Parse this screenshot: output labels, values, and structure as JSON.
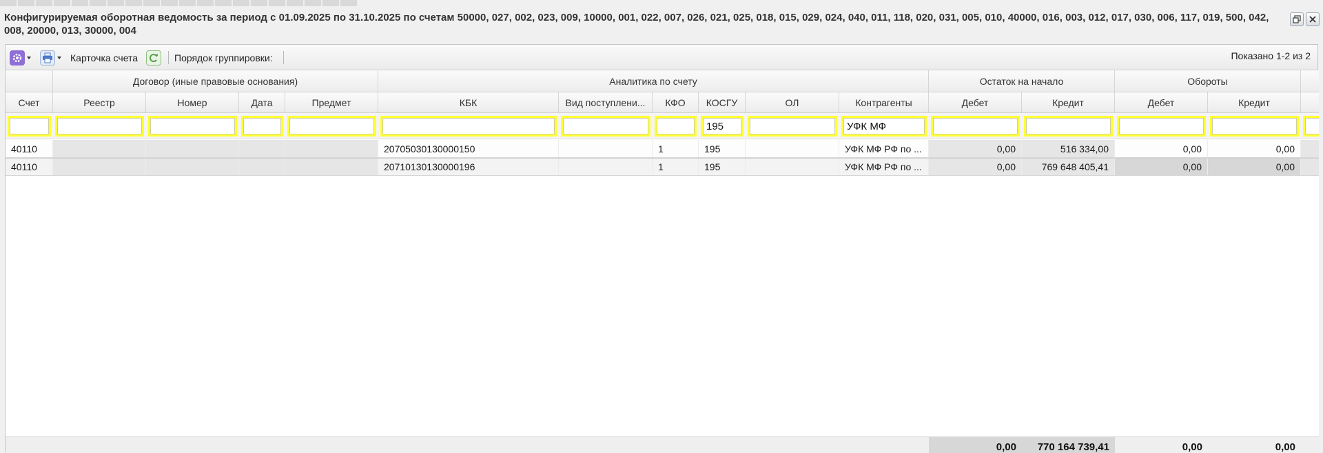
{
  "window": {
    "title": "Конфигурируемая оборотная ведомость за период с 01.09.2025 по 31.10.2025 по счетам 50000, 027, 002, 023, 009, 10000, 001, 022, 007, 026, 021, 025, 018, 015, 029, 024, 040, 011, 118, 020, 031, 005, 010, 40000, 016, 003, 012, 017, 030, 006, 117, 019, 500, 042, 008, 20000, 013, 30000, 004",
    "icons": [
      "restore-icon",
      "close-icon"
    ]
  },
  "toolbar": {
    "settings_icon": "gear-icon",
    "print_icon": "printer-icon",
    "account_card_label": "Карточка счета",
    "refresh_icon": "refresh-icon",
    "grouping_label": "Порядок группировки:",
    "shown_label": "Показано 1-2 из 2"
  },
  "grid": {
    "group_headers": {
      "contract": "Договор (иные правовые основания)",
      "analytics": "Аналитика по счету",
      "opening_balance": "Остаток на начало",
      "turnover": "Обороты"
    },
    "columns": {
      "account": "Счет",
      "registry": "Реестр",
      "number": "Номер",
      "date": "Дата",
      "subject": "Предмет",
      "kbk": "КБК",
      "income_type": "Вид поступлени...",
      "kfo": "КФО",
      "kosgu": "КОСГУ",
      "ol": "ОЛ",
      "counterparties": "Контрагенты",
      "ob_debit": "Дебет",
      "ob_credit": "Кредит",
      "to_debit": "Дебет",
      "to_credit": "Кредит"
    },
    "filters": {
      "kosgu": "195",
      "counterparties": "УФК МФ"
    },
    "rows": [
      {
        "account": "40110",
        "kbk": "20705030130000150",
        "kfo": "1",
        "kosgu": "195",
        "counterparty": "УФК МФ РФ по ...",
        "ob_debit": "0,00",
        "ob_credit": "516 334,00",
        "to_debit": "0,00",
        "to_credit": "0,00"
      },
      {
        "account": "40110",
        "kbk": "20710130130000196",
        "kfo": "1",
        "kosgu": "195",
        "counterparty": "УФК МФ РФ по ...",
        "ob_debit": "0,00",
        "ob_credit": "769 648 405,41",
        "to_debit": "0,00",
        "to_credit": "0,00"
      }
    ],
    "totals": {
      "ob_debit": "0,00",
      "ob_credit": "770 164 739,41",
      "to_debit": "0,00",
      "to_credit": "0,00"
    }
  },
  "colors": {
    "filter_border": "#ffff33",
    "settings_button": "#8e6fd6",
    "print_button": "#4a78c7",
    "refresh_button": "#5aa04a"
  }
}
